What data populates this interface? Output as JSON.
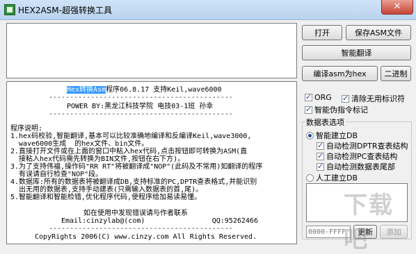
{
  "window": {
    "title": "HEX2ASM-超强转换工具",
    "close_glyph": "✕"
  },
  "toolbar": {
    "open": "打开",
    "save": "保存ASM文件",
    "smart": "智能翻译",
    "compile": "编译asm为hex",
    "binary": "二进制"
  },
  "readme": {
    "highlight": "Hex转换Asm",
    "line1_rest": "程序06.8.17 支持Keil,wave6000",
    "sep1": "--------------------------------------------",
    "line2": "POWER BY:黑龙江科技学院 电技03-1班 孙幸",
    "sep2": "--------------------------------------------",
    "line3": "程序说明:",
    "line4": "1.hex码校验,智能翻译,基本可以比较准确地编译和反编译Keil,wave3000,",
    "line5": "  wave6000生成  的hex文件、bin文件。",
    "line6": "2.直接打开文件或在上面的窗口中粘入hex代码,点击按钮即可转换为ASM(直",
    "line7": "  接粘入hex代码需先转换为BIN文件,按钮在右下方)。",
    "line8": "3.为了支持伟福,操作码\"RR RT\"将被翻译成\"NOP\"(此码及不常用)如翻译的程序",
    "line9": "  有误请自行检查\"NOP\"段。",
    "line10": "4.数据库:所有的数据表将被翻译成DB,支持标准的PC,DPTR查表格式,并能识别",
    "line11": "  出无用的数据表,支持手动建表(只需输入数据表的首,尾)。",
    "line12": "5.智能翻译和智能检错,优化程序代码,使程序给加易读易懂。",
    "line13": "如在使用中发现错误请与作者联系",
    "line14": "Email:cinzylab@(com)                QQ:95262466",
    "sep3": "--------------------------------------------",
    "line15": "CopyRights 2006(C) www.cinzy.com All Rights Reserved."
  },
  "options": {
    "org": "ORG",
    "clear_labels": "清除无用标识符",
    "smart_pseudo": "智能伪指令标记"
  },
  "datatable": {
    "group_label": "数据表选项",
    "auto": "智能建立DB",
    "dptr": "自动检测DPTR查表结构",
    "pc": "自动检测PC查表结构",
    "tail": "自动检测数据表尾部",
    "manual": "人工建立DB",
    "range_placeholder": "0000-FFFF",
    "update": "更新",
    "add": "添加"
  },
  "watermark": "下载吧"
}
